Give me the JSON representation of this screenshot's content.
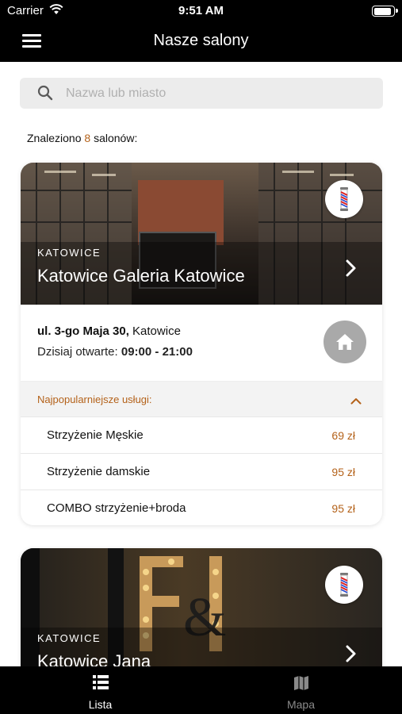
{
  "status_bar": {
    "carrier": "Carrier",
    "time": "9:51 AM",
    "battery_level": 0.95
  },
  "nav": {
    "title": "Nasze salony",
    "menu_icon": "hamburger-menu-icon"
  },
  "search": {
    "placeholder": "Nazwa lub miasto",
    "value": "",
    "icon": "search-icon"
  },
  "results": {
    "prefix": "Znaleziono",
    "count": "8",
    "suffix": "salonów:"
  },
  "salons": [
    {
      "city": "KATOWICE",
      "name": "Katowice Galeria Katowice",
      "address_street": "ul. 3-go Maja 30,",
      "address_city": "Katowice",
      "hours_label": "Dzisiaj otwarte:",
      "hours": "09:00 - 21:00",
      "popular_label": "Najpopularniejsze usługi:",
      "services": [
        {
          "name": "Strzyżenie Męskie",
          "price": "69 zł"
        },
        {
          "name": "Strzyżenie damskie",
          "price": "95 zł"
        },
        {
          "name": "COMBO strzyżenie+broda",
          "price": "95 zł"
        }
      ]
    },
    {
      "city": "KATOWICE",
      "name": "Katowice Jana"
    }
  ],
  "tabs": [
    {
      "label": "Lista",
      "icon": "list-icon",
      "active": true
    },
    {
      "label": "Mapa",
      "icon": "map-icon",
      "active": false
    }
  ],
  "colors": {
    "accent": "#b4621a",
    "bar_background": "#000000",
    "search_background": "#ececec"
  }
}
